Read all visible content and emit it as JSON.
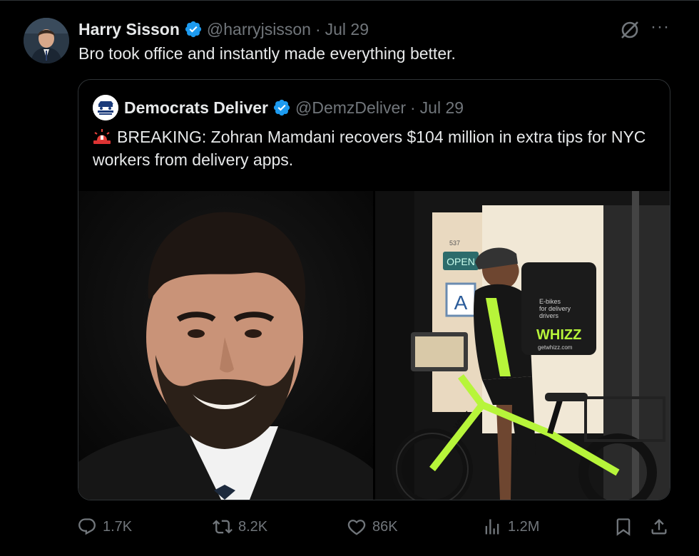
{
  "tweet": {
    "author_name": "Harry Sisson",
    "handle": "@harryjsisson",
    "separator": "·",
    "date": "Jul 29",
    "text": "Bro took office and instantly made everything better.",
    "more_label": "···"
  },
  "quoted": {
    "author_name": "Democrats Deliver",
    "handle": "@DemzDeliver",
    "separator": "·",
    "date": "Jul 29",
    "text": "BREAKING: Zohran Mamdani recovers $104 million in extra tips for NYC workers from delivery apps.",
    "avatar_logo_text": "DEMOCRATS DELIVER",
    "images": [
      {
        "description_icon": "portrait-photo"
      },
      {
        "description_icon": "delivery-worker-photo",
        "sign_text": "OPEN",
        "bag_text": [
          "E-bikes",
          "for delivery",
          "drivers",
          "WHIZZ",
          "getwhizz.com"
        ],
        "address_text": "537",
        "letter_sign": "A",
        "bike_text": "Whizz"
      }
    ]
  },
  "actions": {
    "replies": "1.7K",
    "reposts": "8.2K",
    "likes": "86K",
    "views": "1.2M"
  },
  "colors": {
    "background": "#000000",
    "text": "#e7e9ea",
    "muted": "#71767b",
    "border": "#2f3336",
    "verified": "#1d9bf0"
  }
}
